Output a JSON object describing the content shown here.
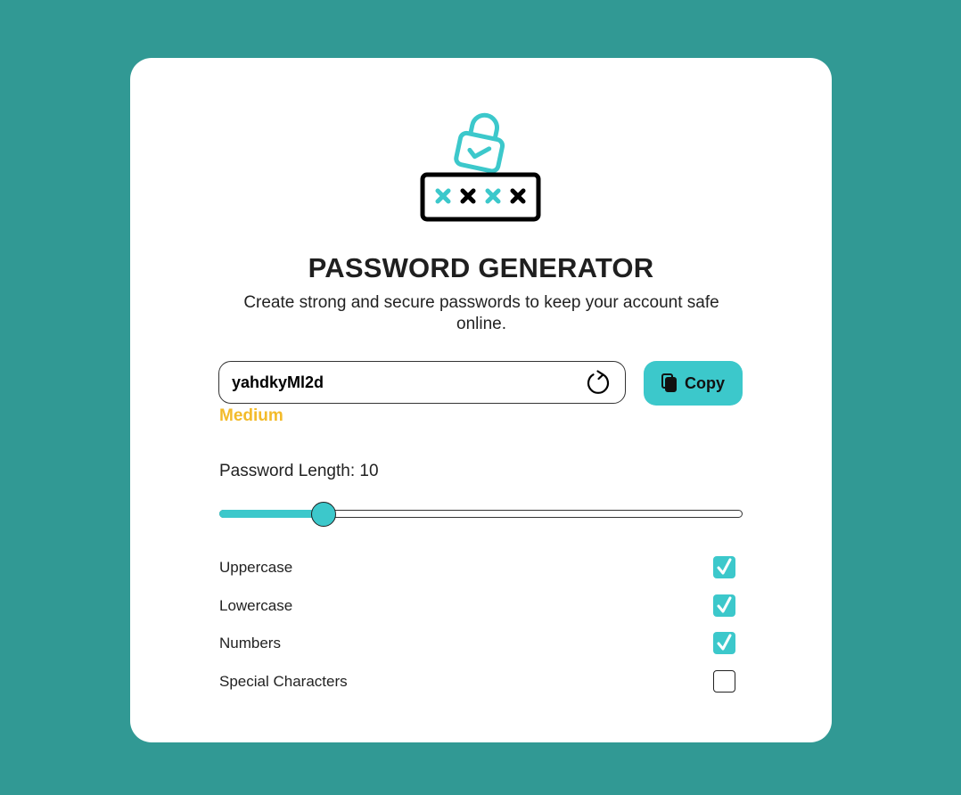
{
  "app": {
    "title": "PASSWORD GENERATOR",
    "subtitle": "Create strong and secure passwords to keep your account safe online."
  },
  "password": {
    "value": "yahdkyMl2d",
    "strength": "Medium",
    "refresh_icon": "refresh-icon",
    "copy_label": "Copy",
    "copy_icon": "copy-icon"
  },
  "length": {
    "label": "Password Length: 10",
    "value": 10,
    "slider_fraction": 0.2
  },
  "options": [
    {
      "label": "Uppercase",
      "checked": true
    },
    {
      "label": "Lowercase",
      "checked": true
    },
    {
      "label": "Numbers",
      "checked": true
    },
    {
      "label": "Special Characters",
      "checked": false
    }
  ],
  "colors": {
    "background": "#319994",
    "accent": "#3cc8cb",
    "strength_medium": "#f3bb2a",
    "card": "#ffffff"
  }
}
